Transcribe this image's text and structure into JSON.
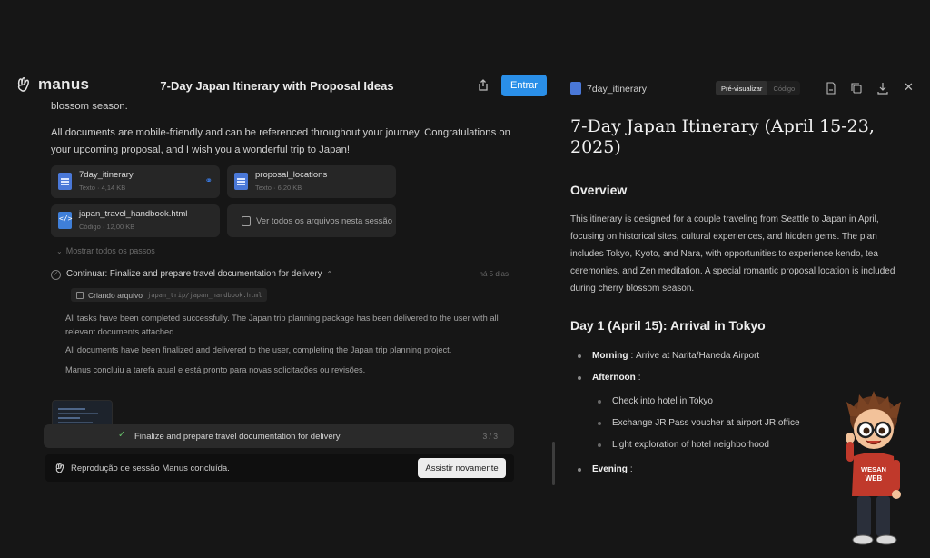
{
  "app": {
    "logo_text": "manus",
    "title": "7-Day Japan Itinerary with Proposal Ideas",
    "login_label": "Entrar"
  },
  "chat": {
    "fragment": "blossom season.",
    "message": "All documents are mobile-friendly and can be referenced throughout your journey. Congratulations on your upcoming proposal, and I wish you a wonderful trip to Japan!",
    "files": [
      {
        "name": "7day_itinerary",
        "meta": "Texto · 4,14 KB",
        "icon": "text-doc-icon",
        "linked": true
      },
      {
        "name": "proposal_locations",
        "meta": "Texto · 6,20 KB",
        "icon": "text-doc-icon",
        "linked": false
      },
      {
        "name": "japan_travel_handbook.html",
        "meta": "Código · 12,00 KB",
        "icon": "code-doc-icon",
        "linked": false
      }
    ],
    "view_all_label": "Ver todos os arquivos nesta sessão",
    "show_all_label": "Mostrar todos os passos",
    "step": {
      "label": "Continuar: Finalize and prepare travel documentation for delivery",
      "time": "há 5 dias"
    },
    "creating": {
      "label": "Criando arquivo",
      "path": "japan_trip/japan_handbook.html"
    },
    "log": [
      "All tasks have been completed successfully. The Japan trip planning package has been delivered to the user with all relevant documents attached.",
      "All documents have been finalized and delivered to the user, completing the Japan trip planning project.",
      "Manus concluiu a tarefa atual e está pronto para novas solicitações ou revisões."
    ],
    "task_bar": {
      "label": "Finalize and prepare travel documentation for delivery",
      "count": "3 / 3"
    },
    "replay": {
      "text": "Reprodução de sessão Manus concluída.",
      "button_label": "Assistir novamente"
    }
  },
  "preview": {
    "doc_name": "7day_itinerary",
    "tabs": [
      "Pré-visualizar",
      "Código"
    ],
    "active_tab": 0,
    "h1": "7-Day Japan Itinerary (April 15-23, 2025)",
    "overview_heading": "Overview",
    "overview_text": "This itinerary is designed for a couple traveling from Seattle to Japan in April, focusing on historical sites, cultural experiences, and hidden gems. The plan includes Tokyo, Kyoto, and Nara, with opportunities to experience kendo, tea ceremonies, and Zen meditation. A special romantic proposal location is included during cherry blossom season.",
    "day1_heading": "Day 1 (April 15): Arrival in Tokyo",
    "items": [
      {
        "label": "Morning",
        "text": "Arrive at Narita/Haneda Airport"
      },
      {
        "label": "Afternoon",
        "text": ""
      },
      {
        "label": "Evening",
        "text": ""
      }
    ],
    "sub_items": [
      "Check into hotel in Tokyo",
      "Exchange JR Pass voucher at airport JR office",
      "Light exploration of hotel neighborhood"
    ]
  },
  "mascot": {
    "shirt_text_1": "WESAN",
    "shirt_text_2": "WEB"
  },
  "colors": {
    "accent": "#2a8fe8",
    "background": "#161616",
    "card": "#262626"
  }
}
